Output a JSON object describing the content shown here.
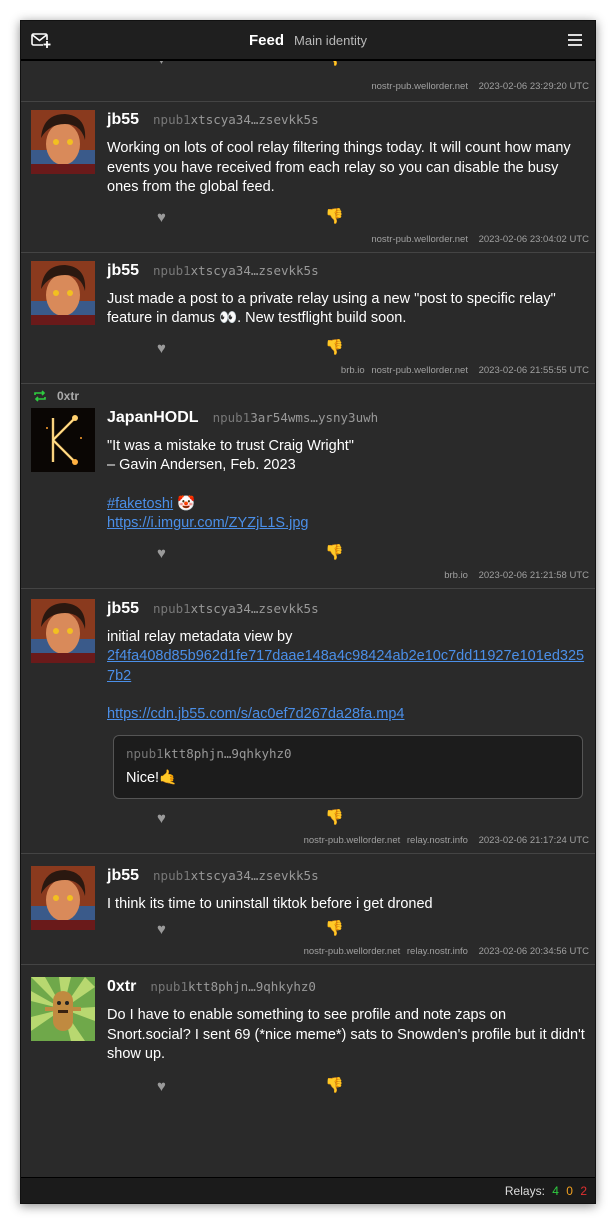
{
  "header": {
    "title": "Feed",
    "subtitle": "Main identity",
    "compose_icon": "mail-plus-icon",
    "menu_icon": "hamburger-menu-icon"
  },
  "partial_top": {
    "relays": [
      "nostr-pub.wellorder.net"
    ],
    "time": "2023-02-06 23:29:20 UTC"
  },
  "notes": [
    {
      "author": "jb55",
      "npub_prefix": "npub1",
      "npub_rest": "xtscya34…zsevkk5s",
      "text": "Working on lots of cool relay filtering things today. It will count how many events you have received from each relay so you can disable the busy ones from the global feed.",
      "relays": [
        "nostr-pub.wellorder.net"
      ],
      "time": "2023-02-06 23:04:02 UTC"
    },
    {
      "author": "jb55",
      "npub_prefix": "npub1",
      "npub_rest": "xtscya34…zsevkk5s",
      "text": "Just made a post to a private relay using a new \"post to specific relay\" feature in damus 👀. New testflight build soon.",
      "relays": [
        "brb.io",
        "nostr-pub.wellorder.net"
      ],
      "time": "2023-02-06 21:55:55 UTC"
    },
    {
      "reposted_by": "0xtr",
      "author": "JapanHODL",
      "npub_prefix": "npub1",
      "npub_rest": "3ar54wms…ysny3uwh",
      "text_line1": "\"It was a mistake to trust Craig Wright\"",
      "text_line2": "– Gavin Andersen, Feb. 2023",
      "hashtag": "#faketoshi",
      "emoji": "🤡",
      "link": "https://i.imgur.com/ZYZjL1S.jpg",
      "relays": [
        "brb.io"
      ],
      "time": "2023-02-06 21:21:58 UTC"
    },
    {
      "author": "jb55",
      "npub_prefix": "npub1",
      "npub_rest": "xtscya34…zsevkk5s",
      "text": "initial relay metadata view by",
      "link1": "2f4fa408d85b962d1fe717daae148a4c98424ab2e10c7dd11927e101ed3257b2",
      "link2": "https://cdn.jb55.com/s/ac0ef7d267da28fa.mp4",
      "quote_npub_prefix": "npub1",
      "quote_npub_rest": "ktt8phjn…9qhkyhz0",
      "quote_text": "Nice!🤙",
      "relays": [
        "nostr-pub.wellorder.net",
        "relay.nostr.info"
      ],
      "time": "2023-02-06 21:17:24 UTC"
    },
    {
      "author": "jb55",
      "npub_prefix": "npub1",
      "npub_rest": "xtscya34…zsevkk5s",
      "text": "I think its time to uninstall tiktok before i get droned",
      "relays": [
        "nostr-pub.wellorder.net",
        "relay.nostr.info"
      ],
      "time": "2023-02-06 20:34:56 UTC"
    },
    {
      "author": "0xtr",
      "npub_prefix": "npub1",
      "npub_rest": "ktt8phjn…9qhkyhz0",
      "text": "Do I have to enable something to see profile and note zaps on Snort.social? I sent 69 (*nice meme*) sats to Snowden's profile but it didn't show up."
    }
  ],
  "actions": {
    "like_glyph": "♥",
    "dislike_glyph": "👎"
  },
  "status": {
    "label": "Relays:",
    "connected": "4",
    "pending": "0",
    "failed": "2",
    "colors": {
      "connected": "#2ecc40",
      "pending": "#f0a020",
      "failed": "#e03030"
    }
  },
  "colors": {
    "link": "#4b8fe8",
    "background": "#2a2a2a",
    "repost": "#2ecc40"
  }
}
